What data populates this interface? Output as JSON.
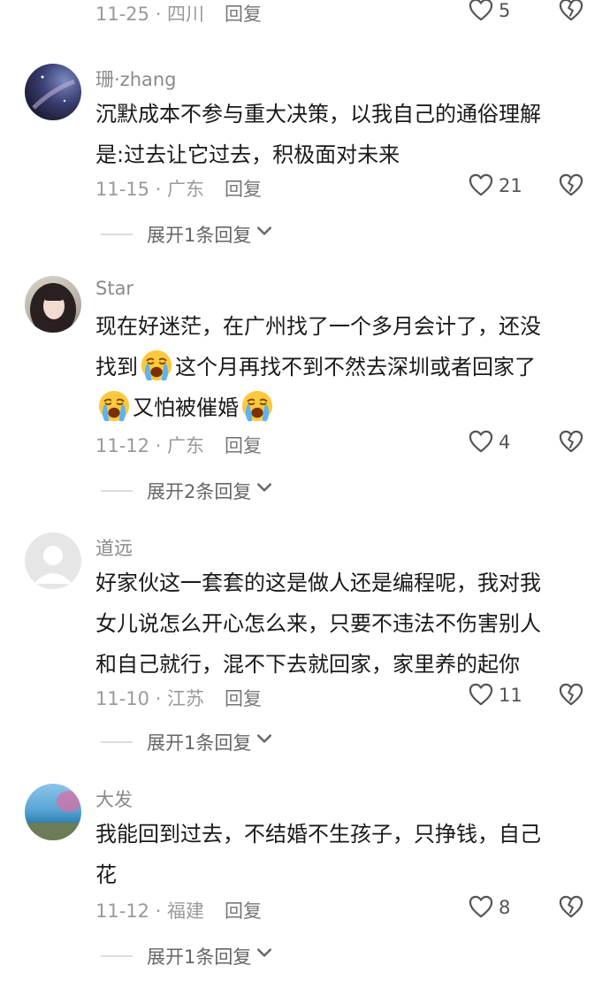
{
  "top_partial": {
    "date_loc": "11-25 · 四川",
    "reply": "回复",
    "like_count": "5"
  },
  "comments": [
    {
      "username": "珊·zhang",
      "lines": [
        "沉默成本不参与重大决策，以我自己的通俗理解",
        "是:过去让它过去，积极面对未来"
      ],
      "date_loc": "11-15 · 广东",
      "reply": "回复",
      "like_count": "21",
      "expand": "展开1条回复"
    },
    {
      "username": "Star",
      "lines": [
        "现在好迷茫，在广州找了一个多月会计了，还没",
        "这个月再找不到不然去深圳或者回家了",
        "又怕被催婚"
      ],
      "line2_prefix": "找到",
      "date_loc": "11-12 · 广东",
      "reply": "回复",
      "like_count": "4",
      "expand": "展开2条回复",
      "emoji": "loudly-crying-face-icon"
    },
    {
      "username": "道远",
      "lines": [
        "好家伙这一套套的这是做人还是编程呢，我对我",
        "女儿说怎么开心怎么来，只要不违法不伤害别人",
        "和自己就行，混不下去就回家，家里养的起你"
      ],
      "date_loc": "11-10 · 江苏",
      "reply": "回复",
      "like_count": "11",
      "expand": "展开1条回复"
    },
    {
      "username": "大发",
      "lines": [
        "我能回到过去，不结婚不生孩子，只挣钱，自己",
        "花"
      ],
      "date_loc": "11-12 · 福建",
      "reply": "回复",
      "like_count": "8",
      "expand": "展开1条回复"
    }
  ],
  "colors": {
    "meta": "#9a9a9a",
    "text": "#1a1a1a",
    "username": "#8a8a8a"
  }
}
